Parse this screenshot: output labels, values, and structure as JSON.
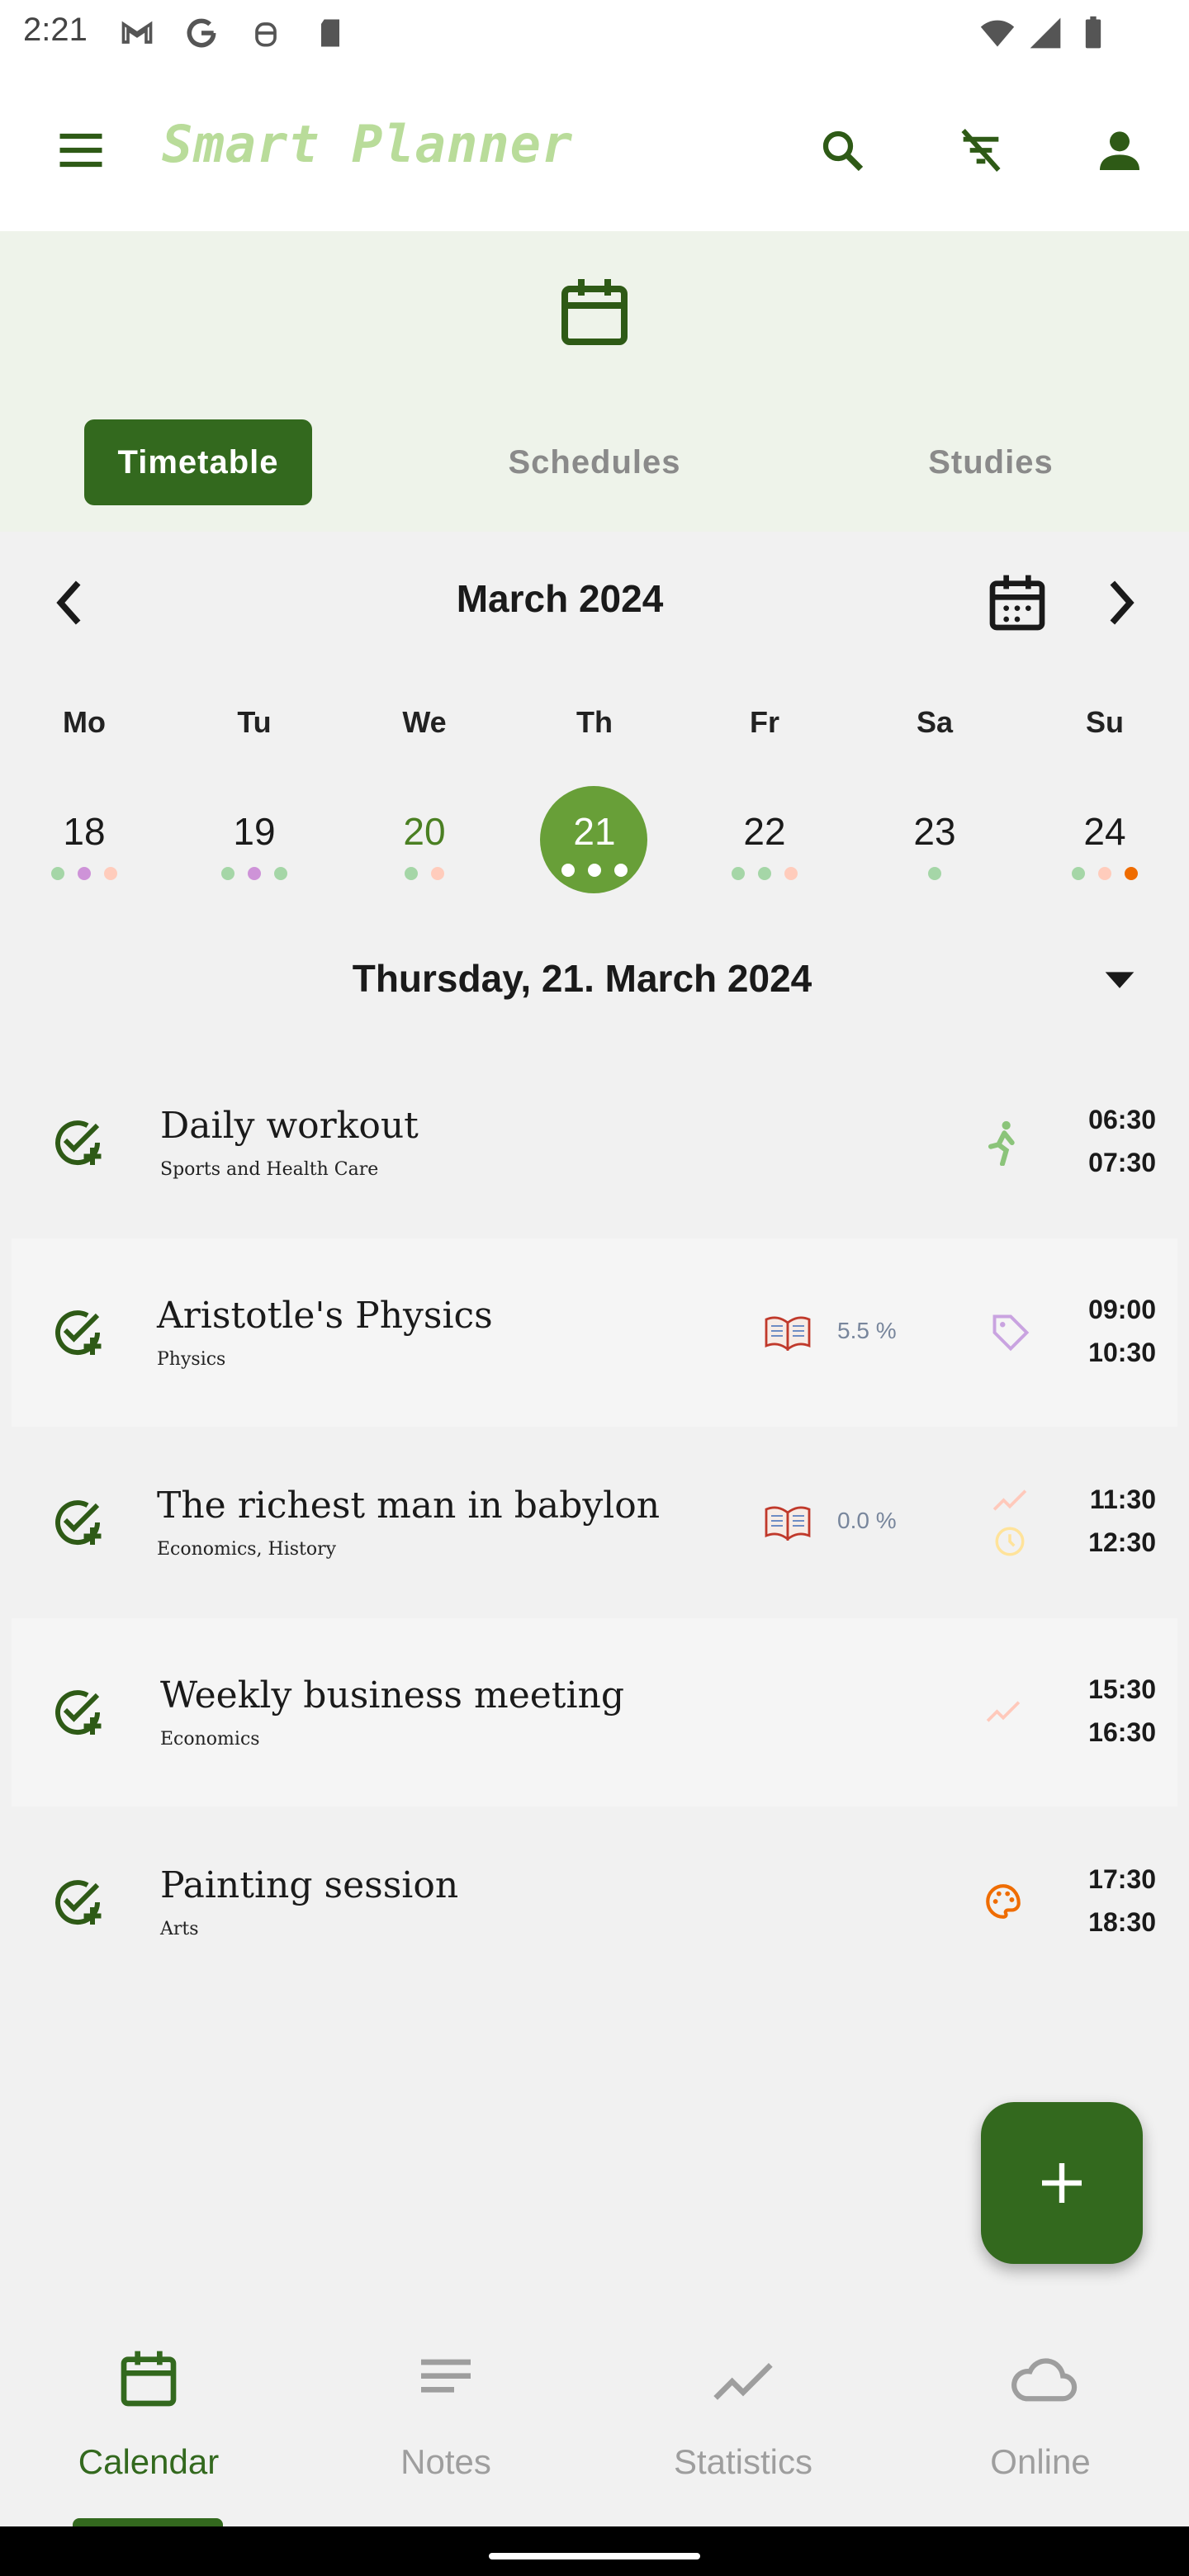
{
  "status_bar": {
    "time": "2:21"
  },
  "app_bar": {
    "title": "Smart Planner",
    "icons": [
      "menu-icon",
      "search-icon",
      "filter-off-icon",
      "account-icon"
    ]
  },
  "header": {
    "icon": "calendar-icon",
    "tabs": [
      {
        "label": "Timetable",
        "active": true
      },
      {
        "label": "Schedules",
        "active": false
      },
      {
        "label": "Studies",
        "active": false
      }
    ]
  },
  "calendar": {
    "month_label": "March 2024",
    "weekdays": [
      "Mo",
      "Tu",
      "We",
      "Th",
      "Fr",
      "Sa",
      "Su"
    ],
    "days": [
      {
        "num": "18",
        "dots": [
          "#a5d6a7",
          "#ce93d8",
          "#ffccbc"
        ]
      },
      {
        "num": "19",
        "dots": [
          "#a5d6a7",
          "#ce93d8",
          "#a5d6a7"
        ]
      },
      {
        "num": "20",
        "dots": [
          "#a5d6a7",
          "#ffccbc"
        ]
      },
      {
        "num": "21",
        "dots": [
          "#ffffff",
          "#ffffff",
          "#ffffff"
        ],
        "selected": true
      },
      {
        "num": "22",
        "dots": [
          "#a5d6a7",
          "#a5d6a7",
          "#ffccbc"
        ]
      },
      {
        "num": "23",
        "dots": [
          "#a5d6a7"
        ]
      },
      {
        "num": "24",
        "dots": [
          "#a5d6a7",
          "#ffccbc",
          "#ef6c00"
        ]
      }
    ],
    "selected_date_label": "Thursday, 21. March 2024"
  },
  "events": [
    {
      "title": "Daily workout",
      "subtitle": "Sports and Health Care",
      "start": "06:30",
      "end": "07:30",
      "icon": "running-icon"
    },
    {
      "title": "Aristotle's Physics",
      "subtitle": "Physics",
      "progress": "5.5 %",
      "start": "09:00",
      "end": "10:30",
      "icon": "tag-icon"
    },
    {
      "title": "The richest man in babylon",
      "subtitle": "Economics, History",
      "progress": "0.0 %",
      "start": "11:30",
      "end": "12:30",
      "icon": "trend-history-icon"
    },
    {
      "title": "Weekly business meeting",
      "subtitle": "Economics",
      "start": "15:30",
      "end": "16:30",
      "icon": "trend-icon"
    },
    {
      "title": "Painting session",
      "subtitle": "Arts",
      "start": "17:30",
      "end": "18:30",
      "icon": "palette-icon"
    }
  ],
  "bottom_nav": [
    {
      "label": "Calendar",
      "icon": "calendar-icon",
      "active": true
    },
    {
      "label": "Notes",
      "icon": "notes-icon",
      "active": false
    },
    {
      "label": "Statistics",
      "icon": "statistics-icon",
      "active": false
    },
    {
      "label": "Online",
      "icon": "cloud-icon",
      "active": false
    }
  ],
  "colors": {
    "primary": "#33691e",
    "accent": "#689f38",
    "title_green": "#b9dc9a",
    "header_bg": "#eef3ea"
  }
}
